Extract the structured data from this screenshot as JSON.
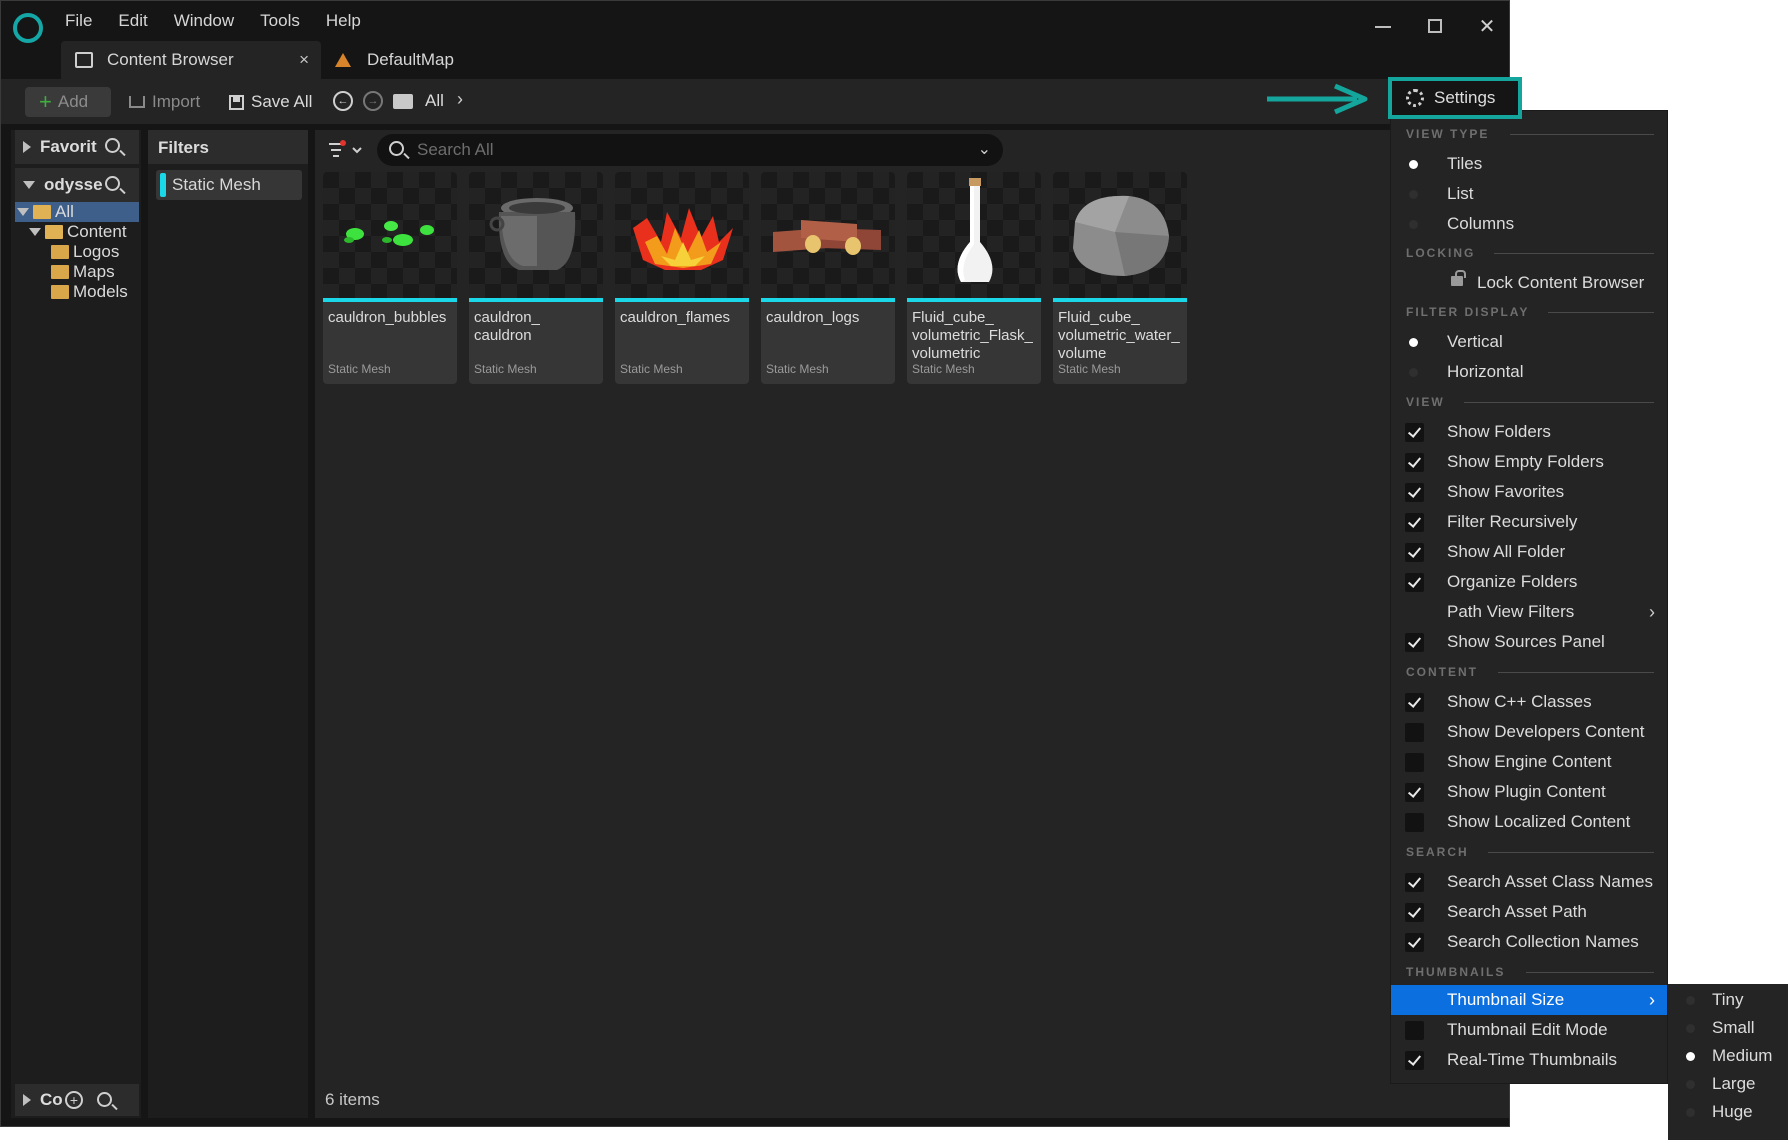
{
  "menubar": [
    "File",
    "Edit",
    "Window",
    "Tools",
    "Help"
  ],
  "tabs": [
    {
      "label": "Content Browser",
      "active": true,
      "close": "×"
    },
    {
      "label": "DefaultMap",
      "active": false
    }
  ],
  "window_controls": {
    "close": "✕"
  },
  "toolbar": {
    "add_label": "Add",
    "import_label": "Import",
    "save_all_label": "Save All",
    "path_current": "All",
    "settings_label": "Settings"
  },
  "sources": {
    "favorites_label": "Favorit",
    "project_label": "odysse",
    "tree": [
      {
        "label": "All",
        "selected": true
      },
      {
        "label": "Content"
      },
      {
        "label": "Logos"
      },
      {
        "label": "Maps"
      },
      {
        "label": "Models"
      }
    ],
    "collections_label": "Co"
  },
  "filters": {
    "header": "Filters",
    "active_filter": "Static Mesh",
    "filter_color": "#1ad8e8"
  },
  "search": {
    "placeholder": "Search All"
  },
  "assets": [
    {
      "name": "cauldron_bubbles",
      "type": "Static Mesh"
    },
    {
      "name": "cauldron_\ncauldron",
      "type": "Static Mesh"
    },
    {
      "name": "cauldron_flames",
      "type": "Static Mesh"
    },
    {
      "name": "cauldron_logs",
      "type": "Static Mesh"
    },
    {
      "name": "Fluid_cube_\nvolumetric_Flask_\nvolumetric",
      "type": "Static Mesh"
    },
    {
      "name": "Fluid_cube_\nvolumetric_water_\nvolume",
      "type": "Static Mesh"
    }
  ],
  "status": {
    "items_count": "6 items"
  },
  "settings_menu": {
    "view_type": {
      "header": "VIEW TYPE",
      "options": [
        {
          "label": "Tiles",
          "selected": true
        },
        {
          "label": "List",
          "selected": false
        },
        {
          "label": "Columns",
          "selected": false
        }
      ]
    },
    "locking": {
      "header": "LOCKING",
      "item": "Lock Content Browser"
    },
    "filter_display": {
      "header": "FILTER DISPLAY",
      "options": [
        {
          "label": "Vertical",
          "selected": true
        },
        {
          "label": "Horizontal",
          "selected": false
        }
      ]
    },
    "view": {
      "header": "VIEW",
      "items": [
        {
          "label": "Show Folders",
          "checked": true
        },
        {
          "label": "Show Empty Folders",
          "checked": true
        },
        {
          "label": "Show Favorites",
          "checked": true
        },
        {
          "label": "Filter Recursively",
          "checked": true
        },
        {
          "label": "Show All Folder",
          "checked": true
        },
        {
          "label": "Organize Folders",
          "checked": true
        },
        {
          "label": "Path View Filters",
          "submenu": true
        },
        {
          "label": "Show Sources Panel",
          "checked": true
        }
      ]
    },
    "content": {
      "header": "CONTENT",
      "items": [
        {
          "label": "Show C++ Classes",
          "checked": true
        },
        {
          "label": "Show Developers Content",
          "checked": false
        },
        {
          "label": "Show Engine Content",
          "checked": false
        },
        {
          "label": "Show Plugin Content",
          "checked": true
        },
        {
          "label": "Show Localized Content",
          "checked": false
        }
      ]
    },
    "search": {
      "header": "SEARCH",
      "items": [
        {
          "label": "Search Asset Class Names",
          "checked": true
        },
        {
          "label": "Search Asset Path",
          "checked": true
        },
        {
          "label": "Search Collection Names",
          "checked": true
        }
      ]
    },
    "thumbnails": {
      "header": "THUMBNAILS",
      "items": [
        {
          "label": "Thumbnail Size",
          "submenu": true,
          "highlighted": true
        },
        {
          "label": "Thumbnail Edit Mode",
          "checked": false
        },
        {
          "label": "Real-Time Thumbnails",
          "checked": true
        }
      ]
    },
    "thumbnail_size_options": [
      {
        "label": "Tiny",
        "selected": false
      },
      {
        "label": "Small",
        "selected": false
      },
      {
        "label": "Medium",
        "selected": true
      },
      {
        "label": "Large",
        "selected": false
      },
      {
        "label": "Huge",
        "selected": false
      }
    ]
  },
  "colors": {
    "accent_teal": "#14a69c",
    "highlight_blue": "#0c6fe0",
    "asset_underline": "#1ad8e8"
  }
}
